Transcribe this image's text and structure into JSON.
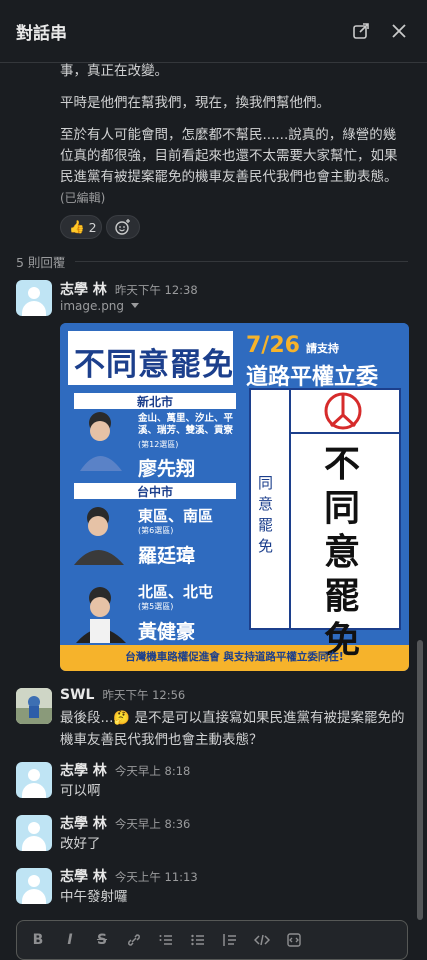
{
  "header": {
    "title": "對話串"
  },
  "top_message": {
    "para1_cont": "事，真正在改變。",
    "para2": "平時是他們在幫我們，現在，換我們幫他們。",
    "para3": "至於有人可能會問，怎麼都不幫民......說真的，綠營的幾位真的都很強，目前看起來也還不太需要大家幫忙，如果民進黨有被提案罷免的機車友善民代我們也會主動表態。",
    "edited": "(已編輯)",
    "reaction_emoji": "👍",
    "reaction_count": "2"
  },
  "replies_label": "5 則回覆",
  "replies": [
    {
      "name": "志學 林",
      "time": "昨天下午 12:38",
      "file": "image.png"
    },
    {
      "name": "SWL",
      "time": "昨天下午 12:56",
      "text_pre": "最後段...",
      "emoji": "🤔",
      "text_post": " 是不是可以直接寫如果民進黨有被提案罷免的機車友善民代我們也會主動表態？"
    },
    {
      "name": "志學 林",
      "time": "今天早上 8:18",
      "text": "可以啊"
    },
    {
      "name": "志學 林",
      "time": "今天早上 8:36",
      "text": "改好了"
    },
    {
      "name": "志學 林",
      "time": "今天上午 11:13",
      "text": "中午發射囉"
    }
  ],
  "poster": {
    "headline": "不同意罷免",
    "date": "7/26",
    "support": "請支持",
    "subtitle": "道路平權立委",
    "city1": "新北市",
    "district1": "金山、萬里、汐止、平溪、瑞芳、雙溪、貢寮",
    "zone1": "(第12選區)",
    "name1": "廖先翔",
    "city2": "台中市",
    "district2": "東區、南區",
    "zone2": "(第6選區)",
    "name2": "羅廷瑋",
    "district3": "北區、北屯",
    "zone3": "(第5選區)",
    "name3": "黃健豪",
    "ballot_left": "同意罷免",
    "ballot_right": "不同意罷免",
    "footer": "台灣機車路權促進會 與支持道路平權立委同在!",
    "colors": {
      "blue": "#2f6bbf",
      "navy": "#1c3f8c",
      "yellow": "#f6b32b",
      "red": "#d62b2b"
    }
  }
}
